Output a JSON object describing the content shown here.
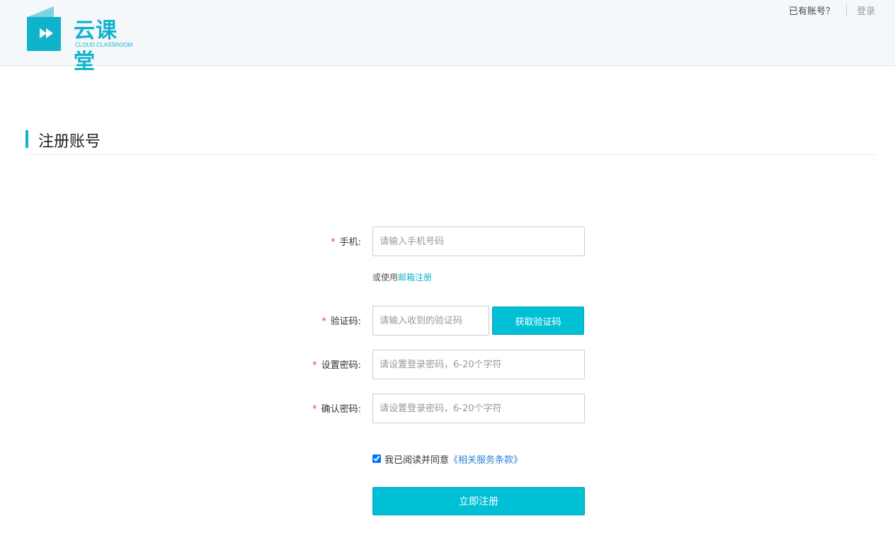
{
  "brand": {
    "name": "云课堂",
    "subtitle": "CLOUD CLASSROOM",
    "color": "#10b3cc",
    "icon": "book-play-icon"
  },
  "header": {
    "has_account_text": "已有账号？",
    "login_label": "登录"
  },
  "page": {
    "title": "注册账号"
  },
  "form": {
    "required_mark": "*",
    "phone": {
      "label": "手机:",
      "placeholder": "请输入手机号码",
      "value": ""
    },
    "email_hint": {
      "prefix": "或使用",
      "link": "邮箱注册"
    },
    "code": {
      "label": "验证码:",
      "placeholder": "请输入收到的验证码",
      "value": "",
      "button": "获取验证码"
    },
    "password": {
      "label": "设置密码:",
      "placeholder": "请设置登录密码，6-20个字符",
      "value": ""
    },
    "confirm": {
      "label": "确认密码:",
      "placeholder": "请设置登录密码，6-20个字符",
      "value": ""
    },
    "agree": {
      "checked": true,
      "text": "我已阅读并同意",
      "link": "《相关服务条款》"
    },
    "submit_label": "立即注册"
  },
  "colors": {
    "accent": "#00c0d6",
    "required": "#e2453c",
    "link": "#2a7fd4"
  }
}
